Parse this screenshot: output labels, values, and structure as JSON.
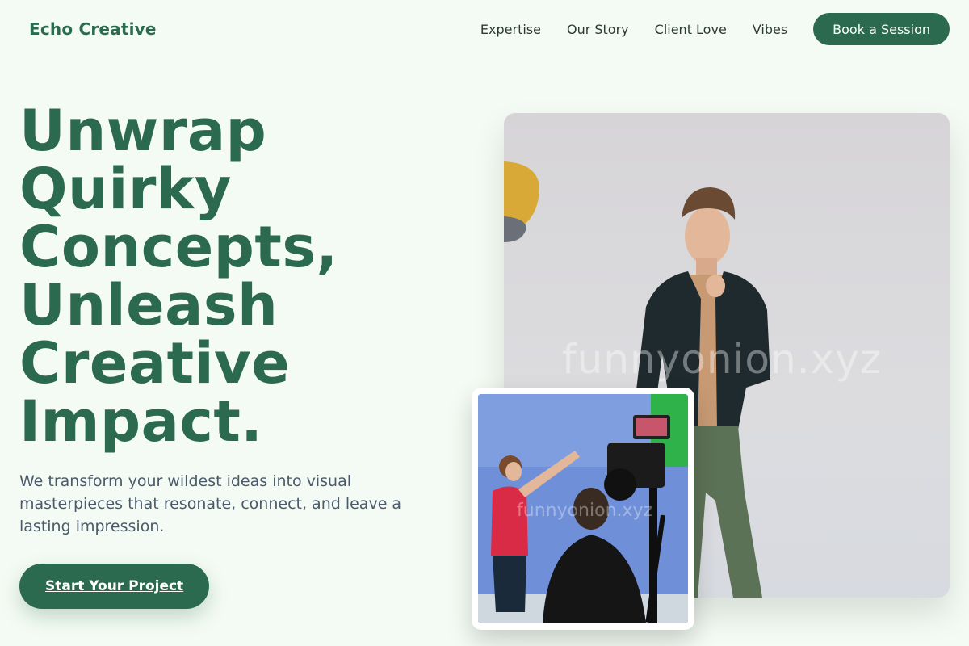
{
  "header": {
    "brand": "Echo Creative",
    "nav": [
      {
        "label": "Expertise"
      },
      {
        "label": "Our Story"
      },
      {
        "label": "Client Love"
      },
      {
        "label": "Vibes"
      }
    ],
    "cta_label": "Book a Session"
  },
  "hero": {
    "title_lines": [
      "Unwrap",
      "Quirky",
      "Concepts,",
      "Unleash",
      "Creative",
      "Impact."
    ],
    "description": "We transform your wildest ideas into visual masterpieces that resonate, connect, and leave a lasting impression.",
    "button_label": "Start Your Project"
  },
  "images": {
    "main_watermark": "funnyonion.xyz",
    "inset_watermark": "funnyonion.xyz"
  },
  "colors": {
    "brand_green": "#2c6a4f",
    "page_bg": "#f4fbf4",
    "body_text": "#4a5a6a"
  }
}
